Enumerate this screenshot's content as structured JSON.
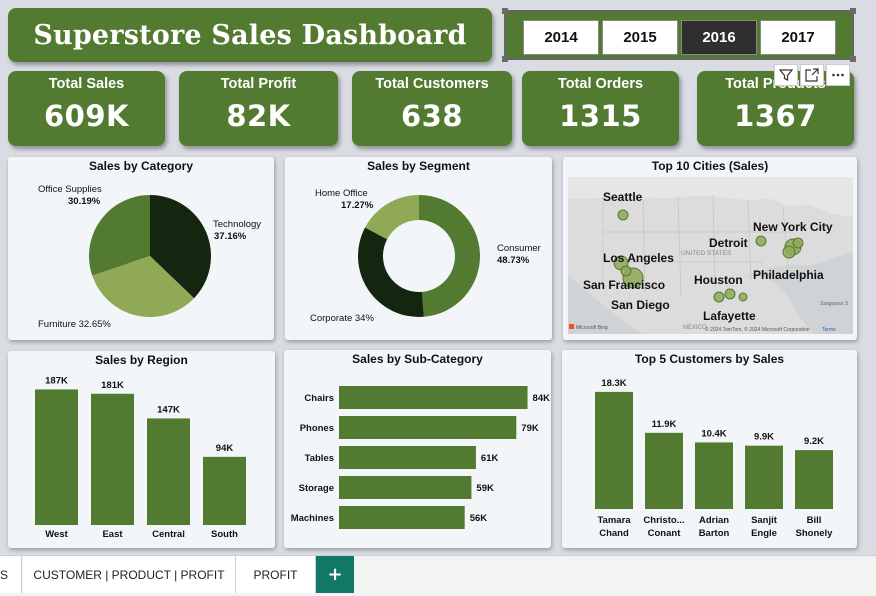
{
  "dashboard": {
    "title": "Superstore Sales Dashboard",
    "years": [
      "2014",
      "2015",
      "2016",
      "2017"
    ],
    "selected_year": "2016",
    "accent_color": "#537a31"
  },
  "kpis": [
    {
      "label": "Total Sales",
      "value": "609K"
    },
    {
      "label": "Total Profit",
      "value": "82K"
    },
    {
      "label": "Total Customers",
      "value": "638"
    },
    {
      "label": "Total Orders",
      "value": "1315"
    },
    {
      "label": "Total Products",
      "value": "1367"
    }
  ],
  "toolbar": {
    "filter_icon": "filter-icon",
    "focus_icon": "focus-mode-icon",
    "more_icon": "more-options-icon"
  },
  "map": {
    "title": "Top 10 Cities (Sales)",
    "cities": [
      "Seattle",
      "New York City",
      "Detroit",
      "Los Angeles",
      "Philadelphia",
      "Houston",
      "San Francisco",
      "San Diego",
      "Lafayette"
    ],
    "country_label": "UNITED STATES",
    "mexico_label": "MEXICO",
    "sargasso_label": "Sargasso S",
    "attribution": "© 2024 TomTom, © 2024 Microsoft Corporation",
    "terms": "Terms",
    "bing": "Microsoft Bing"
  },
  "tabs": {
    "partial": "S",
    "tab1": "CUSTOMER | PRODUCT | PROFIT",
    "tab2": "PROFIT",
    "add": "+"
  },
  "chart_data": [
    {
      "type": "pie",
      "title": "Sales by Category",
      "labels": [
        "Technology",
        "Furniture",
        "Office Supplies"
      ],
      "values": [
        37.16,
        32.65,
        30.19
      ],
      "display": [
        "Technology 37.16%",
        "Furniture 32.65%",
        "Office Supplies 30.19%"
      ],
      "colors": [
        "#14260f",
        "#8fa956",
        "#537a31"
      ]
    },
    {
      "type": "pie",
      "title": "Sales by Segment",
      "donut": true,
      "labels": [
        "Consumer",
        "Corporate",
        "Home Office"
      ],
      "values": [
        48.73,
        34,
        17.27
      ],
      "display": [
        "Consumer 48.73%",
        "Corporate 34%",
        "Home Office 17.27%"
      ],
      "colors": [
        "#537a31",
        "#14260f",
        "#8fa956"
      ]
    },
    {
      "type": "bar",
      "title": "Sales by Region",
      "categories": [
        "West",
        "East",
        "Central",
        "South"
      ],
      "values": [
        187,
        181,
        147,
        94
      ],
      "data_labels": [
        "187K",
        "181K",
        "147K",
        "94K"
      ],
      "ylim": [
        0,
        200
      ]
    },
    {
      "type": "bar",
      "orientation": "horizontal",
      "title": "Sales by Sub-Category",
      "categories": [
        "Chairs",
        "Phones",
        "Tables",
        "Storage",
        "Machines"
      ],
      "values": [
        84,
        79,
        61,
        59,
        56
      ],
      "data_labels": [
        "84K",
        "79K",
        "61K",
        "59K",
        "56K"
      ],
      "xlim": [
        0,
        90
      ]
    },
    {
      "type": "bar",
      "title": "Top 5 Customers by Sales",
      "categories": [
        [
          "Tamara",
          "Chand"
        ],
        [
          "Christo...",
          "Conant"
        ],
        [
          "Adrian",
          "Barton"
        ],
        [
          "Sanjit",
          "Engle"
        ],
        [
          "Bill",
          "Shonely"
        ]
      ],
      "values": [
        18.3,
        11.9,
        10.4,
        9.9,
        9.2
      ],
      "data_labels": [
        "18.3K",
        "11.9K",
        "10.4K",
        "9.9K",
        "9.2K"
      ],
      "ylim": [
        0,
        20
      ]
    }
  ]
}
